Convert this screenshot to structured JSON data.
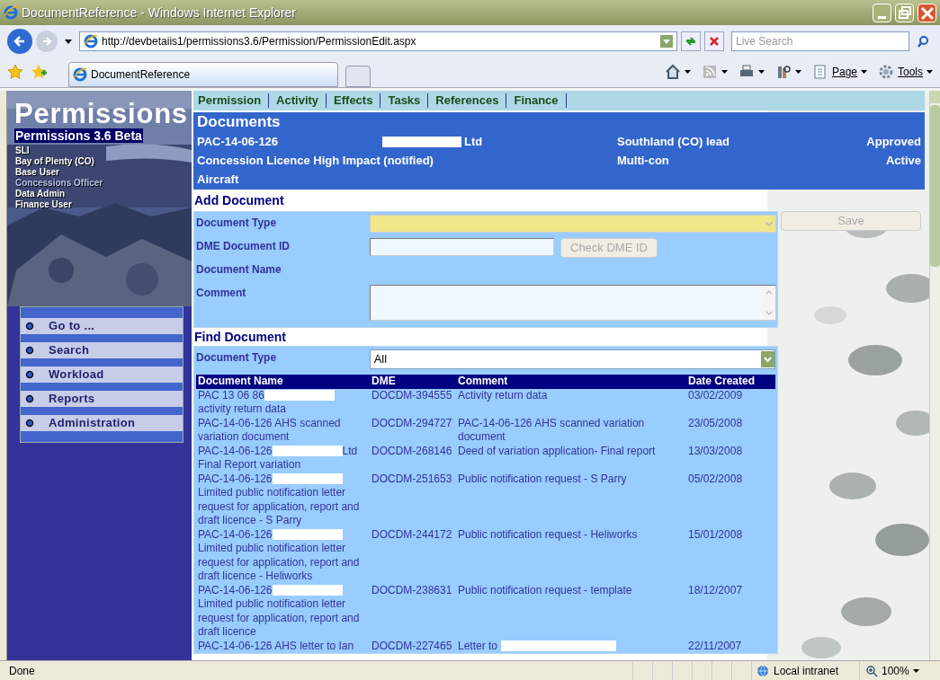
{
  "window": {
    "title": "DocumentReference - Windows Internet Explorer"
  },
  "address_bar": {
    "url": "http://devbetaiis1/permissions3.6/Permission/PermissionEdit.aspx",
    "search_placeholder": "Live Search"
  },
  "browser_tabs": [
    {
      "label": "DocumentReference",
      "selected": true
    }
  ],
  "command_bar": [
    {
      "kind": "home"
    },
    {
      "kind": "feeds"
    },
    {
      "kind": "print"
    },
    {
      "kind": "research"
    },
    {
      "kind": "page",
      "label": "Page"
    },
    {
      "kind": "tools",
      "label": "Tools"
    }
  ],
  "sidebar": {
    "logo": "Permissions",
    "version": "Permissions 3.6 Beta",
    "roles": [
      {
        "label": "SLI",
        "selected": false
      },
      {
        "label": "Bay of Plenty (CO)",
        "selected": false
      },
      {
        "label": "Base User",
        "selected": false
      },
      {
        "label": "Concessions Officer",
        "selected": true
      },
      {
        "label": "Data Admin",
        "selected": false
      },
      {
        "label": "Finance User",
        "selected": false
      }
    ],
    "menu": [
      "Go to ...",
      "Search",
      "Workload",
      "Reports",
      "Administration"
    ]
  },
  "nav_tabs": [
    "Permission",
    "Activity",
    "Effects",
    "Tasks",
    "References",
    "Finance"
  ],
  "header": {
    "title": "Documents",
    "id": "PAC-14-06-126",
    "company": [
      {
        "kind": "redaction"
      },
      "Ltd"
    ],
    "region": "Southland (CO) lead",
    "status": "Approved",
    "type": "Concession Licence High Impact (notified)",
    "kind": "Multi-con",
    "state": "Active",
    "activity": "Aircraft"
  },
  "add_document": {
    "title": "Add Document",
    "fields": [
      {
        "kind": "select",
        "label": "Document Type"
      },
      {
        "kind": "input",
        "label": "DME Document ID",
        "button": "Check DME ID"
      },
      {
        "kind": "text",
        "label": "Document Name"
      },
      {
        "kind": "textarea",
        "label": "Comment"
      }
    ],
    "save": "Save"
  },
  "find_document": {
    "title": "Find Document",
    "filter_label": "Document Type",
    "filter_value": "All"
  },
  "table": {
    "columns": [
      "Document Name",
      "DME",
      "Comment",
      "Date Created"
    ],
    "rows": [
      {
        "name": [
          [
            "PAC 13 06 86",
            {
              "kind": "redaction"
            }
          ],
          [
            "activity return data"
          ]
        ],
        "dme": "DOCDM-394555",
        "comment": [
          "Activity return data"
        ],
        "date": "03/02/2009"
      },
      {
        "name": [
          [
            "PAC-14-06-126 AHS scanned"
          ],
          [
            "variation document"
          ]
        ],
        "dme": "DOCDM-294727",
        "comment": [
          "PAC-14-06-126 AHS scanned variation document"
        ],
        "date": "23/05/2008"
      },
      {
        "name": [
          [
            "PAC-14-06-126",
            {
              "kind": "redaction"
            },
            "Ltd"
          ],
          [
            "Final Report variation"
          ]
        ],
        "dme": "DOCDM-268146",
        "comment": [
          "Deed of variation application- Final report"
        ],
        "date": "13/03/2008"
      },
      {
        "name": [
          [
            "PAC-14-06-126",
            {
              "kind": "redaction"
            }
          ],
          [
            "Limited public notification letter request for application, report and draft licence - S Parry"
          ]
        ],
        "dme": "DOCDM-251653",
        "comment": [
          "Public notification request - S Parry"
        ],
        "date": "05/02/2008"
      },
      {
        "name": [
          [
            "PAC-14-06-126",
            {
              "kind": "redaction"
            }
          ],
          [
            "Limited public notification letter request for application, report and draft licence - Heliworks"
          ]
        ],
        "dme": "DOCDM-244172",
        "comment": [
          "Public notification request - Heliworks"
        ],
        "date": "15/01/2008"
      },
      {
        "name": [
          [
            "PAC-14-06-126",
            {
              "kind": "redaction"
            }
          ],
          [
            "Limited public notification letter request for application, report and draft licence"
          ]
        ],
        "dme": "DOCDM-238631",
        "comment": [
          "Public notification request - template"
        ],
        "date": "18/12/2007"
      },
      {
        "name": [
          [
            "PAC-14-06-126 AHS letter to Ian"
          ]
        ],
        "dme": "DOCDM-227465",
        "comment": [
          "Letter to",
          {
            "kind": "redaction"
          }
        ],
        "date": "22/11/2007"
      }
    ]
  },
  "status_bar": {
    "text": "Done",
    "zone": "Local intranet",
    "zoom": "100%"
  }
}
